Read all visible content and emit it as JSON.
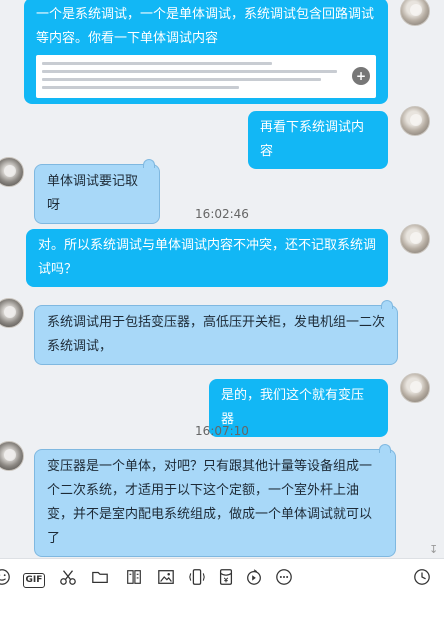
{
  "messages": [
    {
      "side": "right",
      "text": "一个是系统调试，一个是单体调试，系统调试包含回路调试等内容。你看一下单体调试内容"
    },
    {
      "side": "right",
      "text": "再看下系统调试内容"
    },
    {
      "side": "left",
      "text": "单体调试要记取呀"
    },
    {
      "side": "right",
      "text": "对。所以系统调试与单体调试内容不冲突，还不记取系统调试吗？"
    },
    {
      "side": "left",
      "text": "系统调试用于包括变压器，高低压开关柜，发电机组一二次系统调试，"
    },
    {
      "side": "right",
      "text": "是的，我们这个就有变压器"
    },
    {
      "side": "left",
      "text": "变压器是一个单体，对吧？只有跟其他计量等设备组成一个二次系统，才适用于以下这个定额，一个室外杆上油变，并不是室内配电系统组成，做成一个单体调试就可以了"
    }
  ],
  "timestamps": [
    "16:02:46",
    "16:07:10"
  ],
  "icons": [
    "emoji-icon",
    "gif-icon",
    "scissors-icon",
    "folder-icon",
    "doc-icon",
    "image-icon",
    "shake-icon",
    "red-packet-icon",
    "voice-icon",
    "more-icon",
    "history-icon"
  ],
  "toolbar": {
    "gif_label": "GIF"
  },
  "colors": {
    "self_bubble": "#12b7f5",
    "other_bubble": "#a8d8f8",
    "background": "#eef0f3"
  }
}
